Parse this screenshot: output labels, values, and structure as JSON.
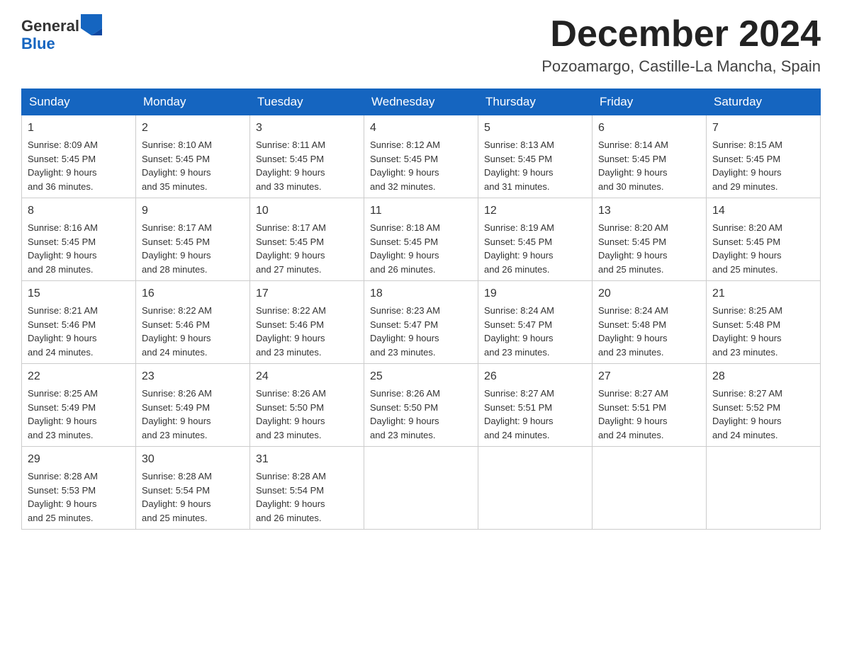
{
  "header": {
    "logo_general": "General",
    "logo_blue": "Blue",
    "title": "December 2024",
    "subtitle": "Pozoamargo, Castille-La Mancha, Spain"
  },
  "days_of_week": [
    "Sunday",
    "Monday",
    "Tuesday",
    "Wednesday",
    "Thursday",
    "Friday",
    "Saturday"
  ],
  "weeks": [
    [
      {
        "day": "1",
        "sunrise": "8:09 AM",
        "sunset": "5:45 PM",
        "daylight": "9 hours and 36 minutes."
      },
      {
        "day": "2",
        "sunrise": "8:10 AM",
        "sunset": "5:45 PM",
        "daylight": "9 hours and 35 minutes."
      },
      {
        "day": "3",
        "sunrise": "8:11 AM",
        "sunset": "5:45 PM",
        "daylight": "9 hours and 33 minutes."
      },
      {
        "day": "4",
        "sunrise": "8:12 AM",
        "sunset": "5:45 PM",
        "daylight": "9 hours and 32 minutes."
      },
      {
        "day": "5",
        "sunrise": "8:13 AM",
        "sunset": "5:45 PM",
        "daylight": "9 hours and 31 minutes."
      },
      {
        "day": "6",
        "sunrise": "8:14 AM",
        "sunset": "5:45 PM",
        "daylight": "9 hours and 30 minutes."
      },
      {
        "day": "7",
        "sunrise": "8:15 AM",
        "sunset": "5:45 PM",
        "daylight": "9 hours and 29 minutes."
      }
    ],
    [
      {
        "day": "8",
        "sunrise": "8:16 AM",
        "sunset": "5:45 PM",
        "daylight": "9 hours and 28 minutes."
      },
      {
        "day": "9",
        "sunrise": "8:17 AM",
        "sunset": "5:45 PM",
        "daylight": "9 hours and 28 minutes."
      },
      {
        "day": "10",
        "sunrise": "8:17 AM",
        "sunset": "5:45 PM",
        "daylight": "9 hours and 27 minutes."
      },
      {
        "day": "11",
        "sunrise": "8:18 AM",
        "sunset": "5:45 PM",
        "daylight": "9 hours and 26 minutes."
      },
      {
        "day": "12",
        "sunrise": "8:19 AM",
        "sunset": "5:45 PM",
        "daylight": "9 hours and 26 minutes."
      },
      {
        "day": "13",
        "sunrise": "8:20 AM",
        "sunset": "5:45 PM",
        "daylight": "9 hours and 25 minutes."
      },
      {
        "day": "14",
        "sunrise": "8:20 AM",
        "sunset": "5:45 PM",
        "daylight": "9 hours and 25 minutes."
      }
    ],
    [
      {
        "day": "15",
        "sunrise": "8:21 AM",
        "sunset": "5:46 PM",
        "daylight": "9 hours and 24 minutes."
      },
      {
        "day": "16",
        "sunrise": "8:22 AM",
        "sunset": "5:46 PM",
        "daylight": "9 hours and 24 minutes."
      },
      {
        "day": "17",
        "sunrise": "8:22 AM",
        "sunset": "5:46 PM",
        "daylight": "9 hours and 23 minutes."
      },
      {
        "day": "18",
        "sunrise": "8:23 AM",
        "sunset": "5:47 PM",
        "daylight": "9 hours and 23 minutes."
      },
      {
        "day": "19",
        "sunrise": "8:24 AM",
        "sunset": "5:47 PM",
        "daylight": "9 hours and 23 minutes."
      },
      {
        "day": "20",
        "sunrise": "8:24 AM",
        "sunset": "5:48 PM",
        "daylight": "9 hours and 23 minutes."
      },
      {
        "day": "21",
        "sunrise": "8:25 AM",
        "sunset": "5:48 PM",
        "daylight": "9 hours and 23 minutes."
      }
    ],
    [
      {
        "day": "22",
        "sunrise": "8:25 AM",
        "sunset": "5:49 PM",
        "daylight": "9 hours and 23 minutes."
      },
      {
        "day": "23",
        "sunrise": "8:26 AM",
        "sunset": "5:49 PM",
        "daylight": "9 hours and 23 minutes."
      },
      {
        "day": "24",
        "sunrise": "8:26 AM",
        "sunset": "5:50 PM",
        "daylight": "9 hours and 23 minutes."
      },
      {
        "day": "25",
        "sunrise": "8:26 AM",
        "sunset": "5:50 PM",
        "daylight": "9 hours and 23 minutes."
      },
      {
        "day": "26",
        "sunrise": "8:27 AM",
        "sunset": "5:51 PM",
        "daylight": "9 hours and 24 minutes."
      },
      {
        "day": "27",
        "sunrise": "8:27 AM",
        "sunset": "5:51 PM",
        "daylight": "9 hours and 24 minutes."
      },
      {
        "day": "28",
        "sunrise": "8:27 AM",
        "sunset": "5:52 PM",
        "daylight": "9 hours and 24 minutes."
      }
    ],
    [
      {
        "day": "29",
        "sunrise": "8:28 AM",
        "sunset": "5:53 PM",
        "daylight": "9 hours and 25 minutes."
      },
      {
        "day": "30",
        "sunrise": "8:28 AM",
        "sunset": "5:54 PM",
        "daylight": "9 hours and 25 minutes."
      },
      {
        "day": "31",
        "sunrise": "8:28 AM",
        "sunset": "5:54 PM",
        "daylight": "9 hours and 26 minutes."
      },
      null,
      null,
      null,
      null
    ]
  ],
  "labels": {
    "sunrise": "Sunrise:",
    "sunset": "Sunset:",
    "daylight": "Daylight:"
  }
}
